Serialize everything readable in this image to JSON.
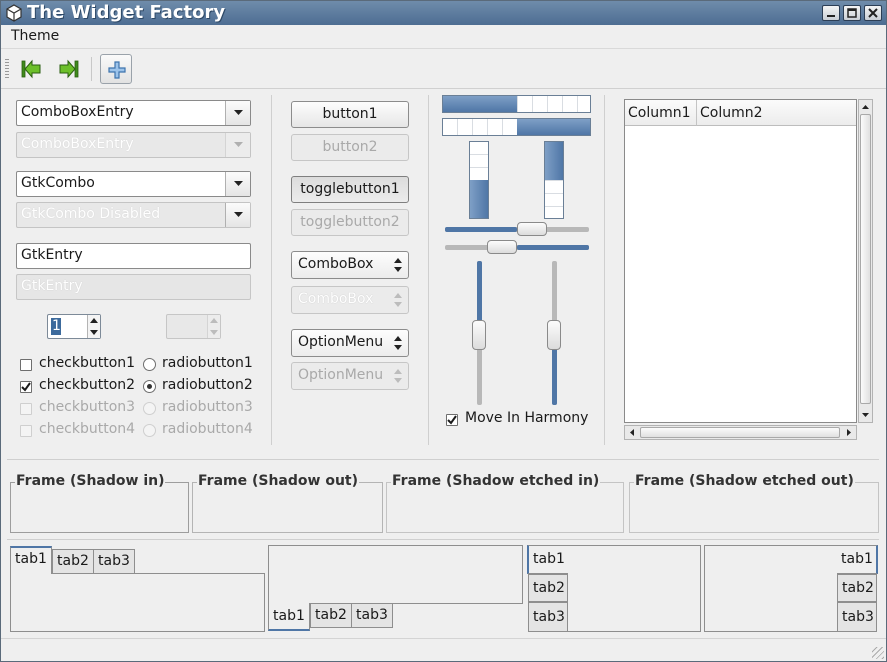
{
  "window": {
    "title": "The Widget Factory"
  },
  "menu": {
    "items": [
      "Theme"
    ]
  },
  "toolbar": {
    "icons": [
      "go-first-icon",
      "go-last-icon",
      "add-icon"
    ]
  },
  "left": {
    "combo_entry": "ComboBoxEntry",
    "combo_entry_disabled": "ComboBoxEntry",
    "gtk_combo": "GtkCombo",
    "gtk_combo_disabled": "GtkCombo Disabled",
    "entry": "GtkEntry",
    "entry_disabled": "GtkEntry",
    "spin_value": "1",
    "checks": [
      {
        "label": "checkbutton1",
        "checked": false,
        "disabled": false
      },
      {
        "label": "checkbutton2",
        "checked": true,
        "disabled": false
      },
      {
        "label": "checkbutton3",
        "checked": false,
        "disabled": true
      },
      {
        "label": "checkbutton4",
        "checked": false,
        "disabled": true
      }
    ],
    "radios": [
      {
        "label": "radiobutton1",
        "selected": false,
        "disabled": false
      },
      {
        "label": "radiobutton2",
        "selected": true,
        "disabled": false
      },
      {
        "label": "radiobutton3",
        "selected": false,
        "disabled": true
      },
      {
        "label": "radiobutton4",
        "selected": false,
        "disabled": true
      }
    ]
  },
  "buttons": {
    "button1": "button1",
    "button2": "button2",
    "toggle1": "togglebutton1",
    "toggle2": "togglebutton2",
    "combobox": "ComboBox",
    "combobox_disabled": "ComboBox",
    "optionmenu": "OptionMenu",
    "optionmenu_disabled": "OptionMenu"
  },
  "ranges": {
    "progress_h1": 0.5,
    "progress_h2": 0.5,
    "progress_v1": 0.5,
    "progress_v2": 0.5,
    "hscale1": 0.5,
    "hscale2": 0.5,
    "vscale1": 0.5,
    "vscale2": 0.5,
    "harmony_label": "Move In Harmony",
    "harmony_checked": true
  },
  "tree": {
    "columns": [
      "Column1",
      "Column2"
    ]
  },
  "frames": [
    "Frame (Shadow in)",
    "Frame (Shadow out)",
    "Frame (Shadow etched in)",
    "Frame (Shadow etched out)"
  ],
  "notebooks": {
    "tabs": [
      "tab1",
      "tab2",
      "tab3"
    ]
  },
  "colors": {
    "accent": "#4f76a6",
    "titlebar": "#5b7ba0"
  }
}
